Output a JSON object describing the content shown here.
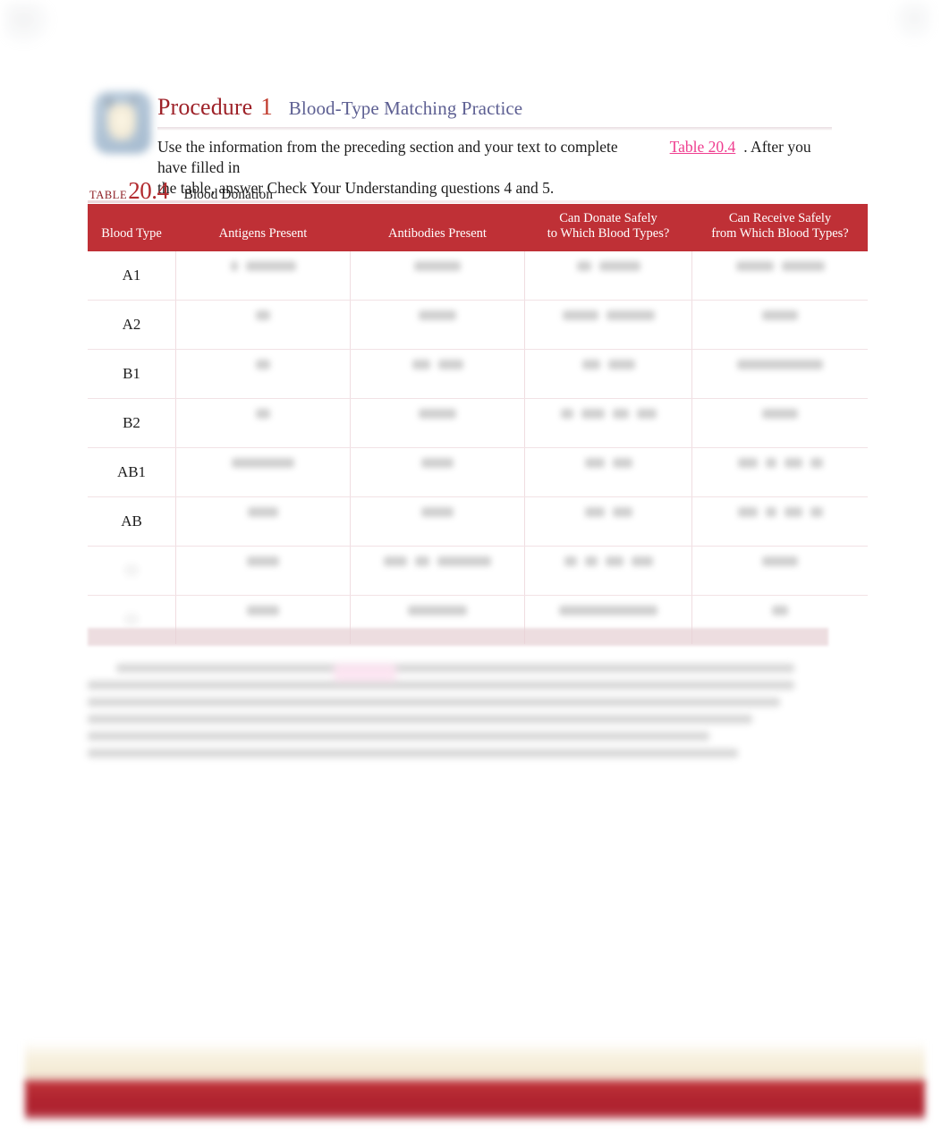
{
  "page": {
    "background_color": "#ffffff",
    "accent_red": "#bf3036",
    "accent_pink": "#ef3d8f",
    "accent_purple": "#5d5f92"
  },
  "procedure": {
    "icon_name": "procedure-badge-icon",
    "word": "Procedure",
    "number": "1",
    "subtitle": "Blood-Type Matching Practice",
    "description_part1": "Use the information from the preceding section and your text to complete",
    "link_text": "Table 20.4",
    "description_part2": ". After you have filled in",
    "description_line2": "the table, answer Check Your Understanding questions 4 and 5."
  },
  "table_caption": {
    "label": "TABLE",
    "number": "20.4",
    "title": "Blood Donation"
  },
  "table": {
    "columns": [
      "Blood Type",
      "Antigens Present",
      "Antibodies Present",
      "Can Donate Safely\nto Which Blood Types?",
      "Can Receive Safely\nfrom Which Blood Types?"
    ],
    "column_headers": {
      "blood_type": "Blood Type",
      "antigens": "Antigens Present",
      "antibodies": "Antibodies Present",
      "donate_line1": "Can Donate Safely",
      "donate_line2": "to Which Blood Types?",
      "receive_line1": "Can Receive Safely",
      "receive_line2": "from Which Blood Types?"
    },
    "rows": [
      {
        "blood_type": "A1",
        "legible": true
      },
      {
        "blood_type": "A2",
        "legible": true
      },
      {
        "blood_type": "B1",
        "legible": true
      },
      {
        "blood_type": "B2",
        "legible": true
      },
      {
        "blood_type": "AB1",
        "legible": true
      },
      {
        "blood_type": "AB",
        "legible": true
      },
      {
        "blood_type": "O",
        "legible": false
      },
      {
        "blood_type": "O",
        "legible": false
      }
    ]
  },
  "bottom_note": {
    "obscured": "true"
  },
  "footer": {
    "cream_bar_color": "#f4ecd6",
    "red_bar_color": "#b1242f"
  }
}
